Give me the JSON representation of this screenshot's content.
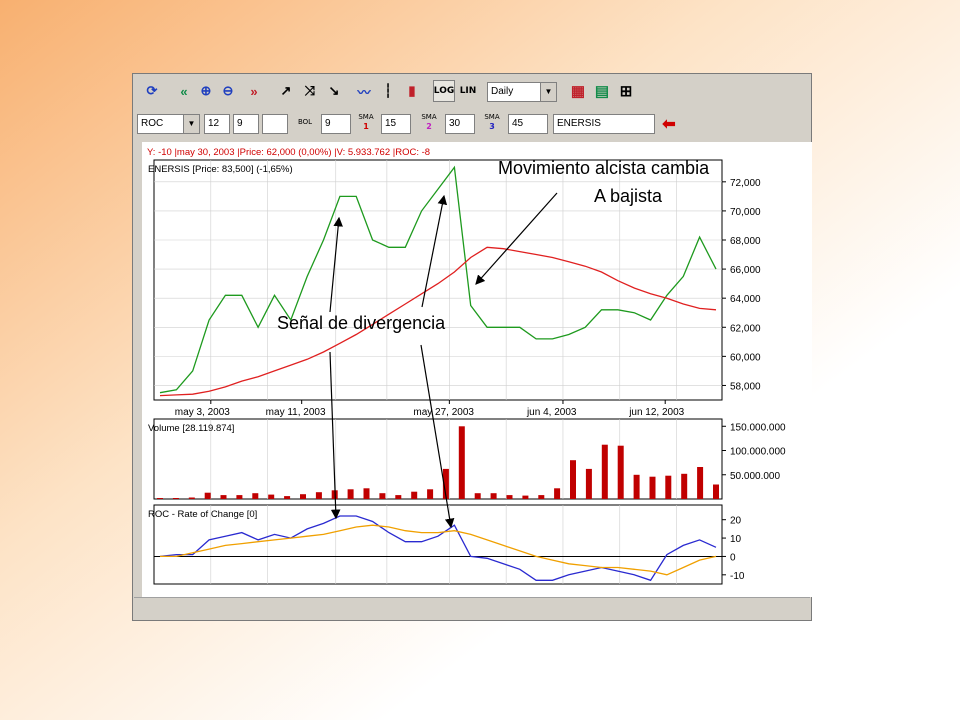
{
  "toolbar": {
    "buttons": [
      {
        "name": "refresh-icon",
        "glyph": "⟳",
        "color": "#1f3fbf"
      },
      {
        "name": "scroll-left-icon",
        "glyph": "«",
        "color": "#138c4a"
      },
      {
        "name": "zoom-in-icon",
        "glyph": "⊕",
        "color": "#1f3fbf"
      },
      {
        "name": "zoom-out-icon",
        "glyph": "⊖",
        "color": "#1f3fbf"
      },
      {
        "name": "scroll-right-icon",
        "glyph": "»",
        "color": "#c0202a"
      },
      {
        "name": "draw-line-add-icon",
        "glyph": "↗",
        "color": "#000000"
      },
      {
        "name": "draw-parallel-icon",
        "glyph": "⤨",
        "color": "#000000"
      },
      {
        "name": "draw-line-remove-icon",
        "glyph": "↘",
        "color": "#000000"
      },
      {
        "name": "line-chart-icon",
        "glyph": "〰",
        "color": "#1f3fbf"
      },
      {
        "name": "bar-chart-icon",
        "glyph": "┆",
        "color": "#000000"
      },
      {
        "name": "candlestick-icon",
        "glyph": "▮",
        "color": "#c0202a"
      }
    ],
    "log_label": "LOG",
    "lin_label": "LIN",
    "period": "Daily",
    "view_buttons": [
      {
        "name": "grid-view-icon",
        "glyph": "▦",
        "color": "#c0202a"
      },
      {
        "name": "table-view-icon",
        "glyph": "▤",
        "color": "#138c4a"
      },
      {
        "name": "split-view-icon",
        "glyph": "⊞",
        "color": "#000000"
      }
    ]
  },
  "params": {
    "indicator": "ROC",
    "roc_period_1": "12",
    "roc_period_2": "9",
    "roc_period_3": "",
    "bol_label": "BOL",
    "bol_value": "9",
    "sma_label": "SMA",
    "sma1_num": "1",
    "sma1_value": "15",
    "sma2_num": "2",
    "sma2_value": "30",
    "sma3_num": "3",
    "sma3_value": "45",
    "symbol": "ENERSIS",
    "go_icon": "back-arrow-icon"
  },
  "info_line": "Y: -10 |may 30, 2003 |Price: 62,000 (0,00%) |V: 5.933.762 |ROC: -8",
  "annotations": {
    "top_line1": "Movimiento alcista cambia",
    "top_line2": "A bajista",
    "middle": "Señal de divergencia"
  },
  "colors": {
    "price": "#1e9a1e",
    "sma": "#e02020",
    "volume": "#c00000",
    "roc": "#2a2ad0",
    "roc_signal": "#f0a000",
    "label_red": "#d00000"
  },
  "chart_data": [
    {
      "type": "line",
      "title": "ENERSIS [Price: 83,500] (-1,65%)",
      "x_ticks": [
        "may 3, 2003",
        "may 11, 2003",
        "may 27, 2003",
        "jun 4, 2003",
        "jun 12, 2003"
      ],
      "y_ticks": [
        "72,000",
        "70,000",
        "68,000",
        "66,000",
        "64,000",
        "62,000",
        "60,000",
        "58,000"
      ],
      "ylim": [
        57000,
        73500
      ],
      "series": [
        {
          "values": [
            57500,
            57700,
            59000,
            62500,
            64200,
            64200,
            62000,
            64200,
            62500,
            65500,
            68000,
            71000,
            71000,
            68000,
            67500,
            67500,
            70000,
            71500,
            73000,
            63500,
            62000,
            62000,
            62000,
            61200,
            61200,
            61500,
            62000,
            63200,
            63200,
            63000,
            62500,
            64200,
            65500,
            68200,
            66000
          ]
        },
        {
          "values": [
            57300,
            57350,
            57400,
            57600,
            57900,
            58300,
            58600,
            59000,
            59400,
            59800,
            60300,
            60900,
            61500,
            62200,
            62900,
            63600,
            64300,
            65000,
            65800,
            66800,
            67500,
            67400,
            67200,
            67000,
            66800,
            66500,
            66200,
            65800,
            65200,
            64700,
            64300,
            64000,
            63600,
            63300,
            63200
          ]
        }
      ]
    },
    {
      "type": "bar",
      "title": "Volume [28.119.874]",
      "y_ticks": [
        "150.000.000",
        "100.000.000",
        "50.000.000"
      ],
      "ylim": [
        0,
        165000000
      ],
      "values": [
        2000000,
        2000000,
        3000000,
        13000000,
        8000000,
        8000000,
        12000000,
        9000000,
        6000000,
        10000000,
        14000000,
        18000000,
        20000000,
        22000000,
        12000000,
        8000000,
        15000000,
        20000000,
        62000000,
        150000000,
        12000000,
        12000000,
        8000000,
        7000000,
        8000000,
        22000000,
        80000000,
        62000000,
        112000000,
        110000000,
        50000000,
        46000000,
        48000000,
        52000000,
        66000000,
        30000000
      ]
    },
    {
      "type": "line",
      "title": "ROC - Rate of Change [0]",
      "y_ticks": [
        "20",
        "10",
        "0",
        "-10"
      ],
      "ylim": [
        -15,
        28
      ],
      "series": [
        {
          "values": [
            0,
            1,
            1,
            9,
            11,
            13,
            9,
            12,
            10,
            15,
            18,
            22,
            22,
            19,
            13,
            8,
            8,
            11,
            17,
            0,
            -1,
            -4,
            -7,
            -13,
            -13,
            -10,
            -8,
            -6,
            -8,
            -10,
            -13,
            1,
            6,
            9,
            5
          ]
        },
        {
          "values": [
            0,
            0,
            2,
            4,
            6,
            7,
            8,
            9,
            10,
            11,
            12,
            14,
            16,
            17,
            16,
            14,
            13,
            13,
            14,
            12,
            9,
            6,
            3,
            0,
            -2,
            -4,
            -5,
            -6,
            -6,
            -7,
            -8,
            -10,
            -6,
            -2,
            0
          ]
        }
      ]
    }
  ]
}
